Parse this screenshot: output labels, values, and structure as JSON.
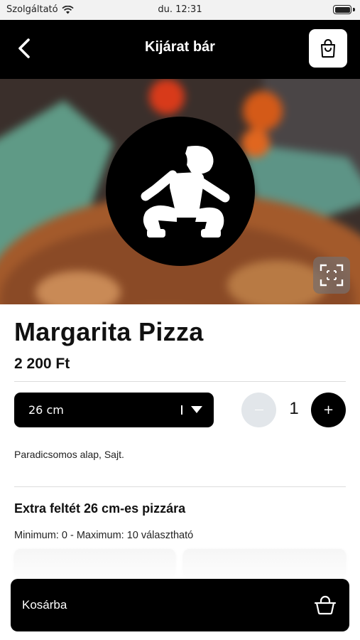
{
  "status_bar": {
    "carrier": "Szolgáltató",
    "time": "du. 12:31"
  },
  "nav": {
    "title": "Kijárat bár",
    "back_icon": "chevron-left-icon",
    "cart_icon": "shopping-bag-icon"
  },
  "product": {
    "name": "Margarita Pizza",
    "price": "2 200 Ft",
    "size_value": "26 cm",
    "quantity": "1",
    "description": "Paradicsomos alap, Sajt."
  },
  "extras": {
    "title": "Extra feltét 26 cm-es pizzára",
    "limits": "Minimum: 0 - Maximum: 10 választható"
  },
  "cta": {
    "label": "Kosárba",
    "icon": "basket-icon"
  },
  "colors": {
    "primary": "#000000",
    "minus_disabled": "#e2e6ea",
    "background": "#ffffff"
  }
}
